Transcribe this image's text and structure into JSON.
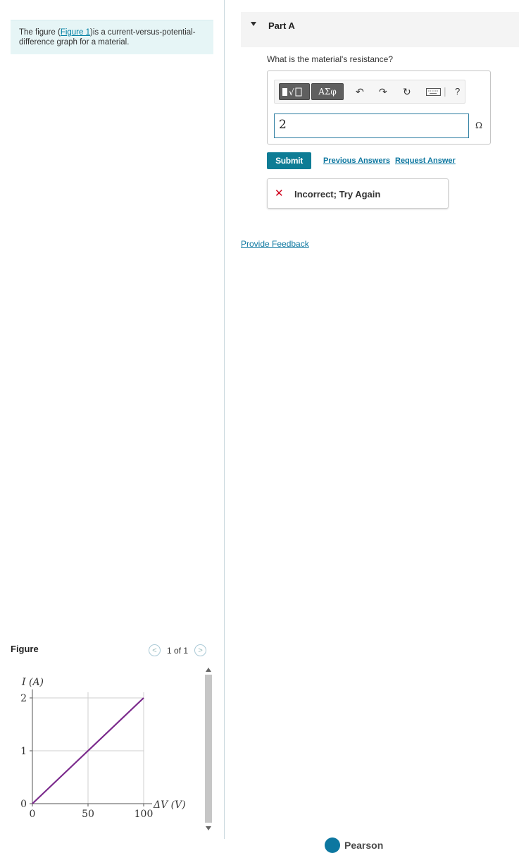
{
  "intro": {
    "text_before": "The figure (",
    "link": "Figure 1",
    "text_after": ")is a current-versus-potential-difference graph for a material."
  },
  "figure_panel": {
    "label": "Figure",
    "pager": "1 of 1"
  },
  "chart_data": {
    "type": "line",
    "title": "",
    "ylabel": "I (A)",
    "xlabel": "ΔV (V)",
    "x_ticks": [
      0,
      50,
      100
    ],
    "y_ticks": [
      0,
      1,
      2
    ],
    "xlim": [
      0,
      100
    ],
    "ylim": [
      0,
      2
    ],
    "grid": true,
    "series": [
      {
        "x": [
          0,
          100
        ],
        "y": [
          0,
          2
        ]
      }
    ],
    "colors": {
      "line": "#7b2a8c",
      "grid": "#cfcfcf",
      "axis": "#555555"
    }
  },
  "part": {
    "title": "Part A"
  },
  "question": "What is the material's resistance?",
  "toolbar": {
    "templates_icon": "templates-icon",
    "symbols_label": "ΑΣφ",
    "undo_icon": "undo-icon",
    "redo_icon": "redo-icon",
    "reset_icon": "reset-icon",
    "keyboard_icon": "keyboard-icon",
    "help_label": "?"
  },
  "answer": {
    "value": "2",
    "unit": "Ω"
  },
  "actions": {
    "submit": "Submit",
    "previous_answers": "Previous Answers",
    "request_answer": "Request Answer"
  },
  "feedback": {
    "text": "Incorrect; Try Again"
  },
  "provide_feedback": "Provide Feedback",
  "footer": {
    "brand": "Pearson"
  },
  "colors": {
    "accent": "#0e7c95",
    "link": "#0d77a0",
    "error": "#d0021b",
    "intro_bg": "#e6f5f6"
  }
}
